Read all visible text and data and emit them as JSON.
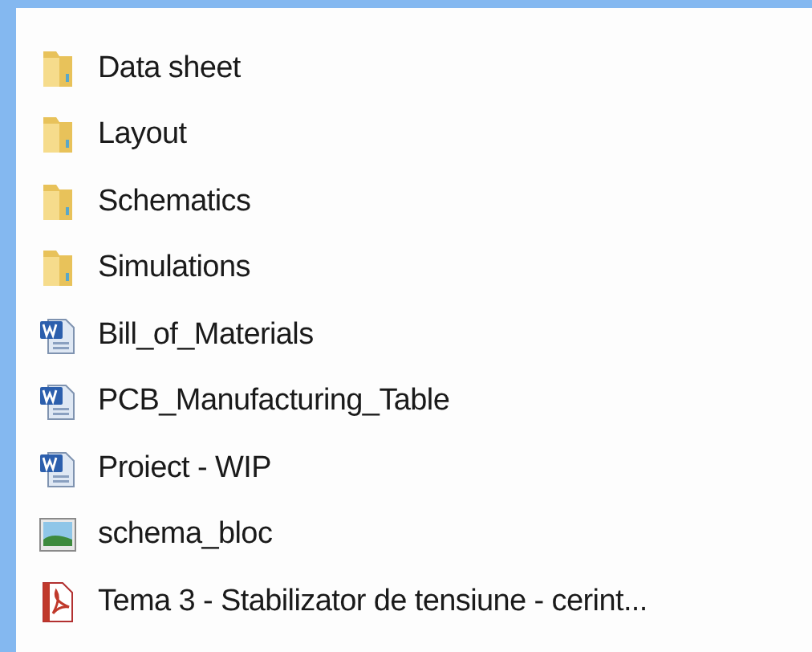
{
  "files": [
    {
      "name": "Data sheet",
      "kind": "folder"
    },
    {
      "name": "Layout",
      "kind": "folder"
    },
    {
      "name": "Schematics",
      "kind": "folder"
    },
    {
      "name": "Simulations",
      "kind": "folder"
    },
    {
      "name": "Bill_of_Materials",
      "kind": "word"
    },
    {
      "name": "PCB_Manufacturing_Table",
      "kind": "word"
    },
    {
      "name": "Proiect - WIP",
      "kind": "word"
    },
    {
      "name": "schema_bloc",
      "kind": "image"
    },
    {
      "name": "Tema 3 - Stabilizator de tensiune - cerint...",
      "kind": "pdf"
    }
  ]
}
